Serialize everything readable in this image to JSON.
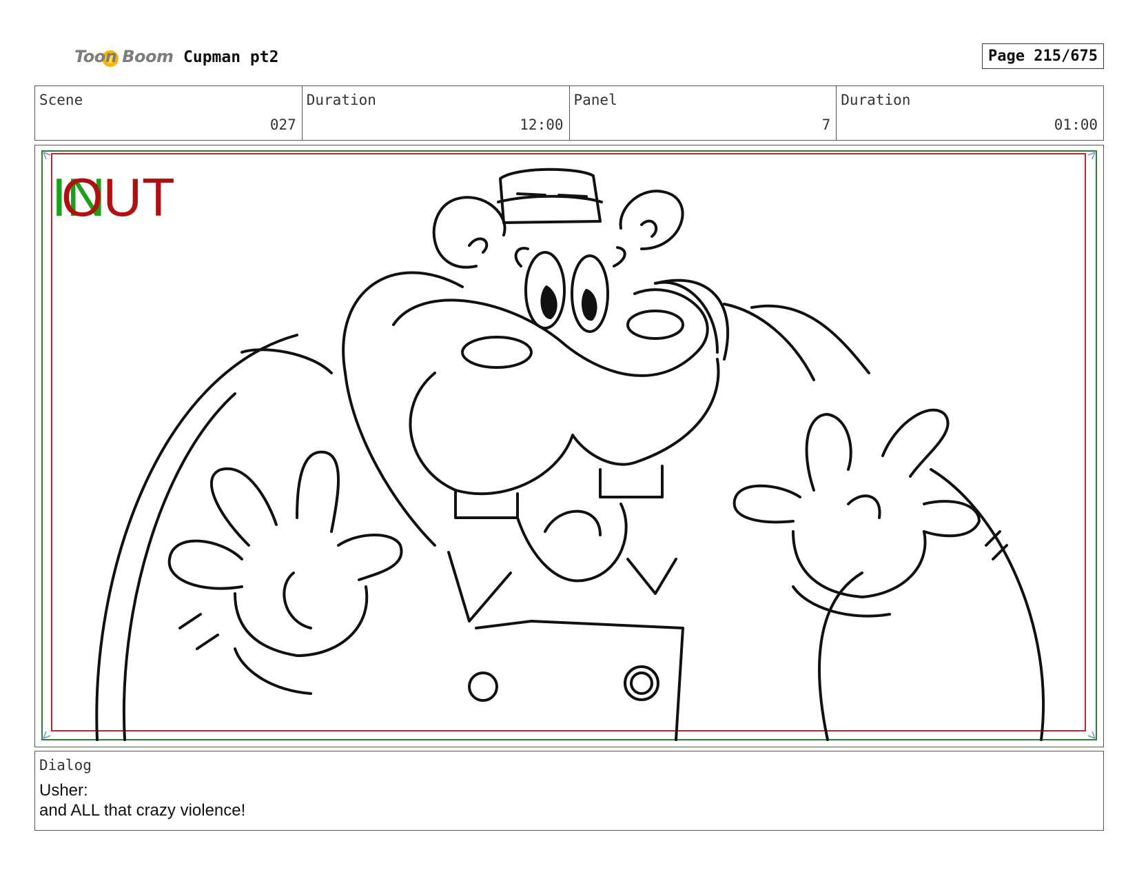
{
  "header": {
    "logo_text": "Toon Boom",
    "project_title": "Cupman pt2",
    "page_label": "Page 215/675"
  },
  "info": {
    "scene_label": "Scene",
    "scene_value": "027",
    "scene_duration_label": "Duration",
    "scene_duration_value": "12:00",
    "panel_label": "Panel",
    "panel_value": "7",
    "panel_duration_label": "Duration",
    "panel_duration_value": "01:00"
  },
  "panel": {
    "in_label": "IN",
    "out_label": "OUT",
    "in_color": "#1aa11a",
    "out_color": "#b01010",
    "safe_frame_color": "#c0272d",
    "field_frame_color": "#2e7d32"
  },
  "dialog": {
    "label": "Dialog",
    "text": "Usher:\nand ALL that crazy violence!"
  }
}
